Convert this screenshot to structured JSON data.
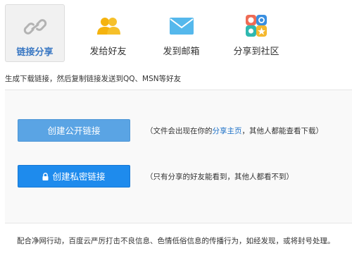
{
  "tabs": [
    {
      "label": "链接分享",
      "icon": "link-icon"
    },
    {
      "label": "发给好友",
      "icon": "friends-icon"
    },
    {
      "label": "发到邮箱",
      "icon": "mail-icon"
    },
    {
      "label": "分享到社区",
      "icon": "community-icon"
    }
  ],
  "description": "生成下载链接，然后复制链接发送到QQ、MSN等好友",
  "public_link": {
    "button_label": "创建公开链接",
    "note_prefix": "（文件会出现在你的",
    "note_link": "分享主页",
    "note_suffix": "，其他人都能查看下载）"
  },
  "private_link": {
    "button_label": "创建私密链接",
    "note": "（只有分享的好友能看到，其他人都看不到）"
  },
  "footer": "配合净网行动，百度云严厉打击不良信息、色情低俗信息的传播行为，如经发现，或将封号处理。",
  "colors": {
    "accent": "#3a78c3",
    "button_primary": "#1e8bed",
    "button_light": "#5aa4e4"
  }
}
